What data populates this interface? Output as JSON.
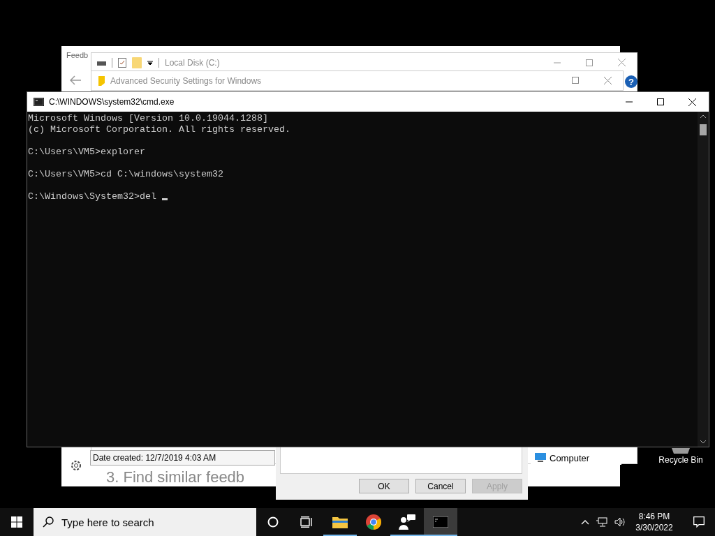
{
  "desktop_icons": [
    {
      "label": "Recycle Bin"
    }
  ],
  "feedback_window": {
    "title": "Feedb",
    "heading": "3. Find similar feedb"
  },
  "explorer_window": {
    "title": "Local Disk (C:)",
    "help_glyph": "?",
    "details": "Date created: 12/7/2019 4:03 AM",
    "nav_item": "Computer"
  },
  "security_window": {
    "title": "Advanced Security Settings for Windows"
  },
  "properties_dialog": {
    "buttons": [
      {
        "label": "OK",
        "disabled": false
      },
      {
        "label": "Cancel",
        "disabled": false
      },
      {
        "label": "Apply",
        "disabled": true
      }
    ]
  },
  "console": {
    "title": "C:\\WINDOWS\\system32\\cmd.exe",
    "blocks": [
      [
        "Microsoft Windows [Version 10.0.19044.1288]",
        "(c) Microsoft Corporation. All rights reserved."
      ],
      [
        "C:\\Users\\VM5>explorer"
      ],
      [
        "C:\\Users\\VM5>cd C:\\windows\\system32"
      ],
      [
        "C:\\Windows\\System32>del"
      ]
    ]
  },
  "taskbar": {
    "search": {
      "placeholder": "Type here to search"
    },
    "apps": [
      {
        "kind": "file-explorer",
        "running": true,
        "selected": false
      },
      {
        "kind": "chrome",
        "running": false,
        "selected": false
      },
      {
        "kind": "people",
        "running": true,
        "selected": false
      },
      {
        "kind": "console",
        "running": true,
        "selected": true
      }
    ],
    "clock": {
      "time": "8:46 PM",
      "date": "3/30/2022"
    }
  }
}
